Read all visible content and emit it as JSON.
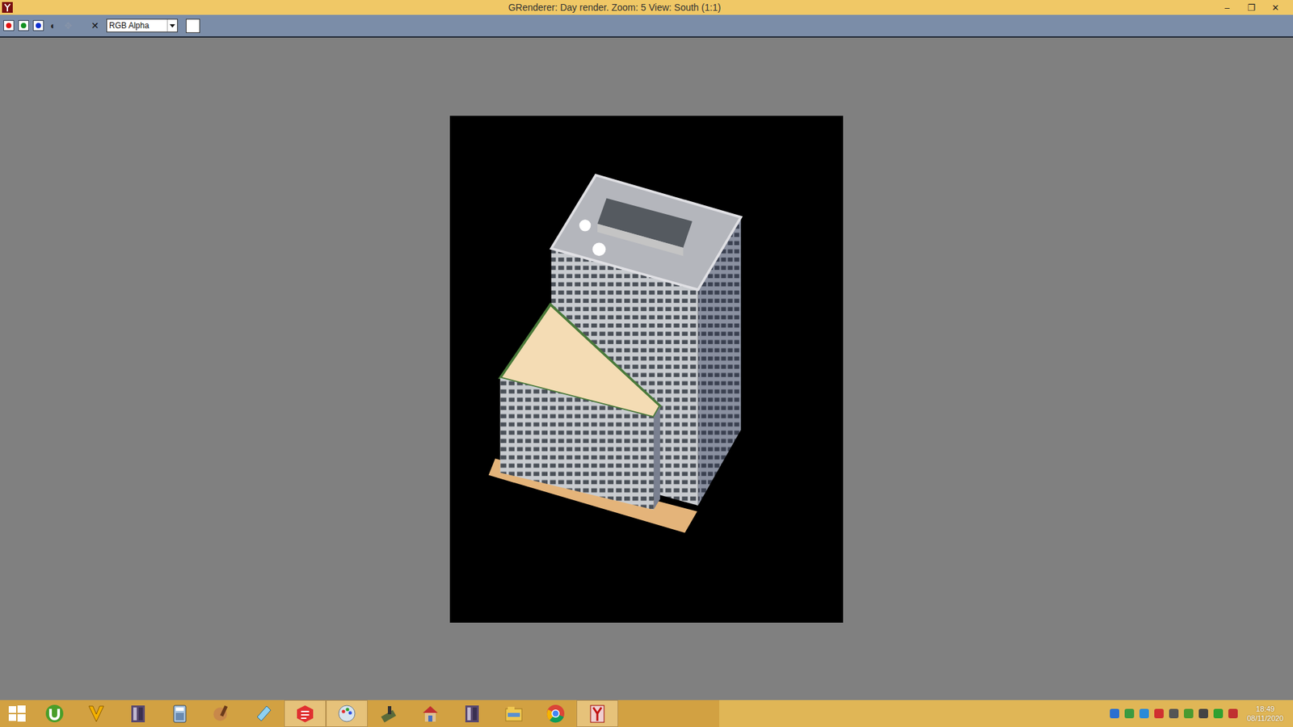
{
  "window": {
    "title": "GRenderer: Day render. Zoom: 5 View: South (1:1)",
    "controls": [
      "–",
      "❐",
      "✕"
    ]
  },
  "toolbar": {
    "buttons": [
      {
        "kind": "channel",
        "label": "",
        "color": "#e01010",
        "on": true,
        "disabled": false
      },
      {
        "kind": "channel",
        "label": "",
        "color": "#109020",
        "on": true,
        "disabled": false
      },
      {
        "kind": "channel",
        "label": "",
        "color": "#1030d0",
        "on": true,
        "disabled": false
      },
      {
        "kind": "glyph",
        "label": "◐",
        "color": "#222222",
        "on": false,
        "disabled": false
      },
      {
        "kind": "glyph",
        "label": "✥",
        "color": "#8a96aa",
        "on": false,
        "disabled": true
      },
      {
        "kind": "glyph",
        "label": "✕",
        "color": "#111111",
        "on": false,
        "disabled": false
      }
    ],
    "view_mode": {
      "value": "RGB Alpha"
    },
    "swatch": {
      "color": "#ffffff"
    }
  },
  "taskbar": {
    "apps": [
      {
        "kind": "start",
        "active": false
      },
      {
        "kind": "utorrent",
        "active": false
      },
      {
        "kind": "vector",
        "active": false
      },
      {
        "kind": "sc4",
        "active": false
      },
      {
        "kind": "calculator",
        "active": false
      },
      {
        "kind": "brush",
        "active": false
      },
      {
        "kind": "notepad",
        "active": false
      },
      {
        "kind": "sketchup",
        "active": true
      },
      {
        "kind": "paint",
        "active": true
      },
      {
        "kind": "tool",
        "active": false
      },
      {
        "kind": "house",
        "active": false
      },
      {
        "kind": "sc4b",
        "active": false
      },
      {
        "kind": "explorer",
        "active": false
      },
      {
        "kind": "chrome",
        "active": false
      },
      {
        "kind": "grenderer",
        "active": true
      }
    ],
    "tray": [
      {
        "color": "#2a6fd0"
      },
      {
        "color": "#3a9a40"
      },
      {
        "color": "#2a8ad8"
      },
      {
        "color": "#d03030"
      },
      {
        "color": "#555555"
      },
      {
        "color": "#4a9a30"
      },
      {
        "color": "#444444"
      },
      {
        "color": "#30a030"
      },
      {
        "color": "#c03030"
      }
    ],
    "clock": {
      "time": "18:49",
      "date": "08/11/2020"
    }
  }
}
